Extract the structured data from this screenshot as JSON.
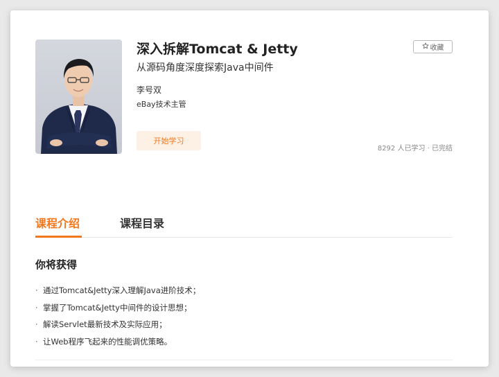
{
  "course": {
    "title": "深入拆解Tomcat & Jetty",
    "subtitle": "从源码角度深度探索Java中间件",
    "author": "李号双",
    "author_role": "eBay技术主管",
    "start_label": "开始学习",
    "favorite_label": "收藏",
    "stats": "8292 人已学习 · 已完结"
  },
  "tabs": [
    {
      "label": "课程介绍",
      "active": true
    },
    {
      "label": "课程目录",
      "active": false
    }
  ],
  "intro": {
    "heading": "你将获得",
    "bullet_symbol": "·",
    "items": [
      "通过Tomcat&Jetty深入理解Java进阶技术；",
      "掌握了Tomcat&Jetty中间件的设计思想；",
      "解读Servlet最新技术及实际应用；",
      "让Web程序飞起来的性能调优策略。"
    ]
  },
  "colors": {
    "accent": "#f2781e",
    "accent_bg": "#fdf0e4",
    "text": "#333333"
  },
  "icons": {
    "favorite": "star-outline-icon"
  }
}
